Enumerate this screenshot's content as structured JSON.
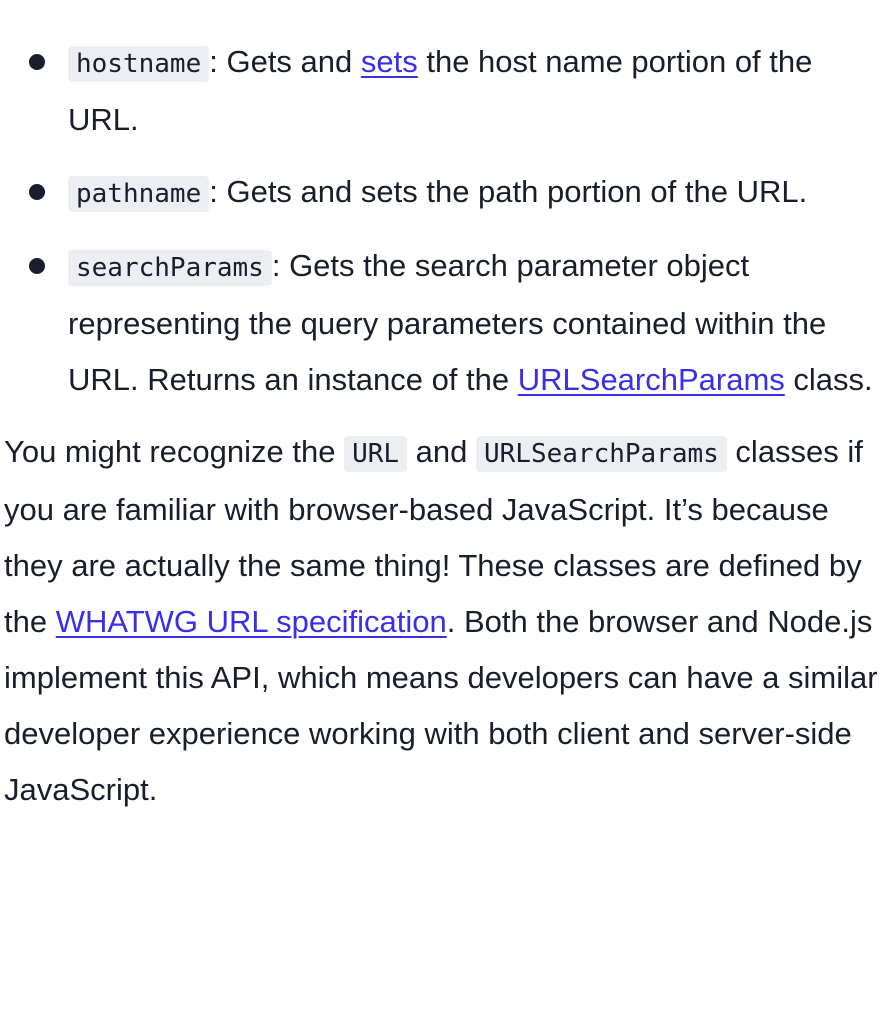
{
  "list": [
    {
      "code": "hostname",
      "pre": ": Gets and ",
      "link": "sets",
      "post": " the host name portion of the URL."
    },
    {
      "code": "pathname",
      "text": ": Gets and sets the path portion of the URL."
    },
    {
      "code": "searchParams",
      "text": ": Gets the search parameter object representing the query parameters contained within the URL. Returns an instance of the ",
      "link": "URLSearchParams",
      "post": " class."
    }
  ],
  "paragraph": {
    "t1": "You might recognize the ",
    "code1": "URL",
    "t2": " and ",
    "code2": "URLSearchParams",
    "t3": " classes if you are familiar with browser-based JavaScript. It’s because they are actually the same thing! These classes are defined by the ",
    "link": "WHATWG URL specification",
    "t4": ". Both the browser and Node.js implement this API, which means developers can have a similar developer experience working with both client and server-side JavaScript."
  },
  "colors": {
    "text": "#1a1d2b",
    "link": "#3a2ee6",
    "code_bg": "#eceef1"
  }
}
